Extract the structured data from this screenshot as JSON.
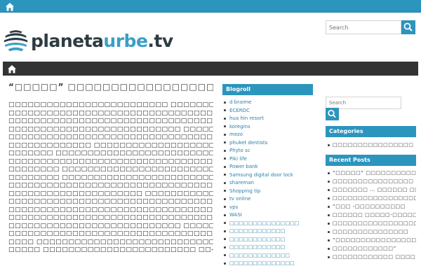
{
  "header": {
    "logo_text_1": "planeta",
    "logo_text_2": "urbe",
    "logo_text_3": ".tv",
    "search_placeholder": "Search"
  },
  "post": {
    "title": "“□□□□□” □□□□□□□□□□□□□□□□□□□□□□□",
    "lines": [
      "□□□□□□□□□□□□□□□□□□□□□□□□□ □□□□□□□□□□□□□□□",
      "□□□□□□□□□□□□□□□□□□□□□□□□□□□□□□□□□□□□□□□□",
      "□□□□□□□□□□□□□□□□□□□□□□□□□□□□□□□□□□□□□□□□",
      "□□□□□□□□□□□□□□□□□□□□□□□□□□□ □□□□□□□□□□□□",
      "□□□□□□□□□□□□□□□□□□□□□□□□□□□□□□□□□□□□□□□□",
      "□□□□□□□□□□□□□ □□□□□□□□□□□□□□□□□□□□□□□□□□",
      "□□□□□□□ □□□□□□□□□□□□□□□□□□□□□□□□□□□□□",
      "□□□□□□□□□□□□□□□□□□□□□□□□□□□□□□□□□□□□□□□□",
      "□□□□□□□□ □□□□□□□□□□□□□□□□□□□□□□□□□□□□□□□",
      "□□□□□□□□ □□□□□□□□□□□□□□□□□□□□□□□□□□□□□□□",
      "□□□□□□□□□□□□□□□□□□□□□□□□□□□□□□□□□□□□□□□□",
      "□□□□□□□□□□□□□□□□□□□□□ □□□□□□□□□□□□□□□□□□",
      "□□□□□□□□□□□□□□□□□□□□□□□□□□□□□□□□□□□□□□□□",
      "□□□□□□□□□□□□□□□□□□□□□□□□□□□□□□□□□ □□□□□□",
      "□□□□□□□□□□□□□□□□□□□□□□□□□□□□□□□□□□□□□□□□",
      "□□□□□□□□□□□□□□□□□□□□□□□□□□□ □□□□□□□□□□□□",
      "□□□□□□□□□□□□□□□□□□□□□□□□□□□□□□□□□□□□□□□□",
      "□□□□ □□□□□□□□□□□□□□□□□□□□□□□□□□□□□□□□□□□",
      "□□□□□ □□□□□□□□□□□□□□□□□□□□□□□□ □□-□□□□□-□□□□"
    ]
  },
  "blogroll": {
    "heading": "Blogroll",
    "items": [
      "d braime",
      "ECERDC",
      "hua hin resort",
      "koregins",
      "mezo",
      "phuket dentists",
      "Phyto sc",
      "Piki life",
      "Power bank",
      "Samsung digital door lock",
      "shareman",
      "Shopping tip",
      "tv online",
      "vps",
      "WASI",
      "□□□□□□□□□□□□□□□",
      "□□□□□□□□□□□□",
      "□□□□□□□□□□□□",
      "□□□□□□□□□□□□",
      "□□□□□□□□□□□□□",
      "□□□□□□□□□□□□□□"
    ]
  },
  "sidebar": {
    "search_placeholder": "Search",
    "categories_heading": "Categories",
    "categories": [
      "□□□□□□□□□□□□□□□□"
    ],
    "recent_heading": "Recent Posts",
    "recent_posts": [
      "“□□□□□” □□□□□□□□□□□□□□□□",
      "□□□□□□□□□□□□□□□□",
      "□□□□□□□ … □□□□□□ □□□",
      "□□□□□□□□□□□□□□□□□□□",
      "“□□□ -□□□□□□□□□□",
      "□□□□□□ □□□□□-□□□□□□□□□",
      "□□□□□□□□□□□□□□□□□”",
      "□□□□□□□□□□□□□□□",
      "“□□□□□□□□□□□□□□□□",
      "□□□□□□□□□□□□”",
      "□□□□□□□□□□□□ □□□□"
    ]
  },
  "colors": {
    "accent": "#2c95bd",
    "navbar": "#333333"
  }
}
